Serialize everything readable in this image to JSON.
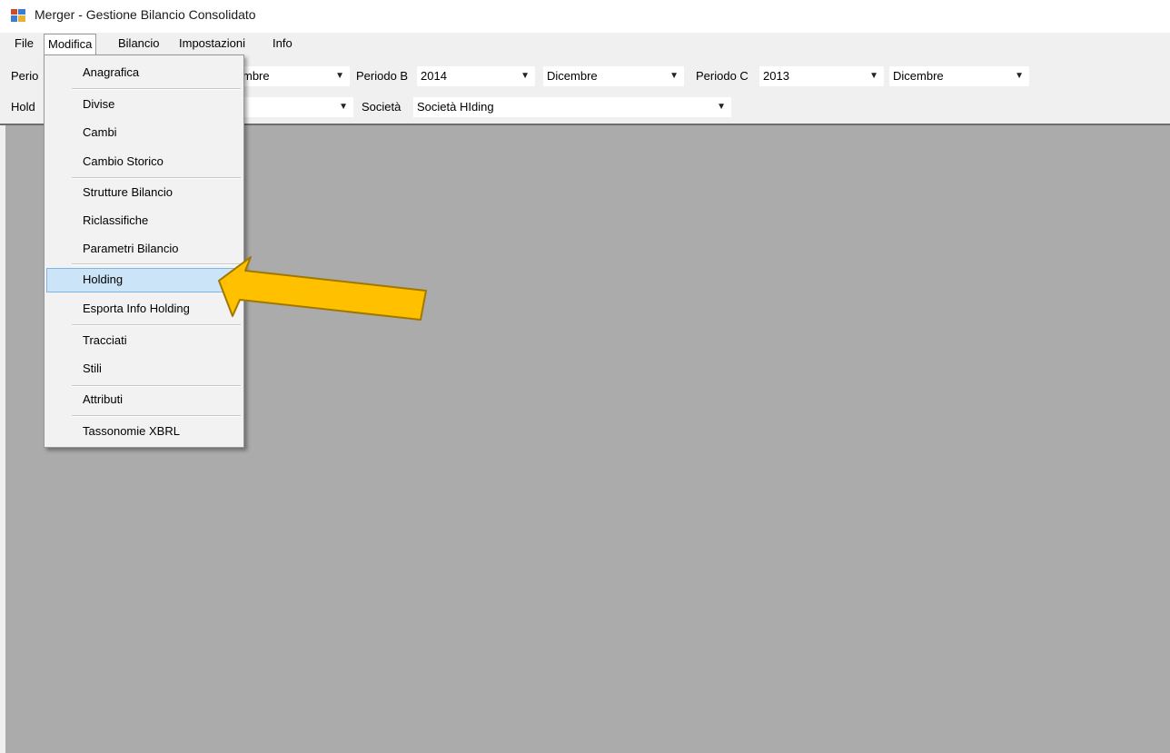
{
  "window": {
    "title": "Merger - Gestione Bilancio Consolidato"
  },
  "menubar": {
    "items": [
      {
        "label": "File"
      },
      {
        "label": "Modifica"
      },
      {
        "label": "Bilancio"
      },
      {
        "label": "Impostazioni"
      },
      {
        "label": "Info"
      }
    ]
  },
  "toolbar": {
    "row1": {
      "periodo_a_label_partial": "Perio",
      "periodo_a_month_partial": "mbre",
      "periodo_b_label": "Periodo B",
      "periodo_b_year": "2014",
      "periodo_b_month": "Dicembre",
      "periodo_c_label": "Periodo C",
      "periodo_c_year": "2013",
      "periodo_c_month": "Dicembre"
    },
    "row2": {
      "holding_label_partial": "Hold",
      "societa_label": "Società",
      "societa_value": "Società HIding"
    }
  },
  "modifica_menu": {
    "items": [
      {
        "label": "Anagrafica"
      },
      {
        "label": "Divise"
      },
      {
        "label": "Cambi"
      },
      {
        "label": "Cambio Storico"
      },
      {
        "label": "Strutture Bilancio"
      },
      {
        "label": "Riclassifiche"
      },
      {
        "label": "Parametri Bilancio"
      },
      {
        "label": "Holding"
      },
      {
        "label": "Esporta Info Holding"
      },
      {
        "label": "Tracciati"
      },
      {
        "label": "Stili"
      },
      {
        "label": "Attributi"
      },
      {
        "label": "Tassonomie XBRL"
      }
    ],
    "highlighted_item": "Holding"
  },
  "annotation": {
    "icon": "pointer-arrow-icon",
    "color": "#ffc000",
    "outline": "#a07800"
  }
}
